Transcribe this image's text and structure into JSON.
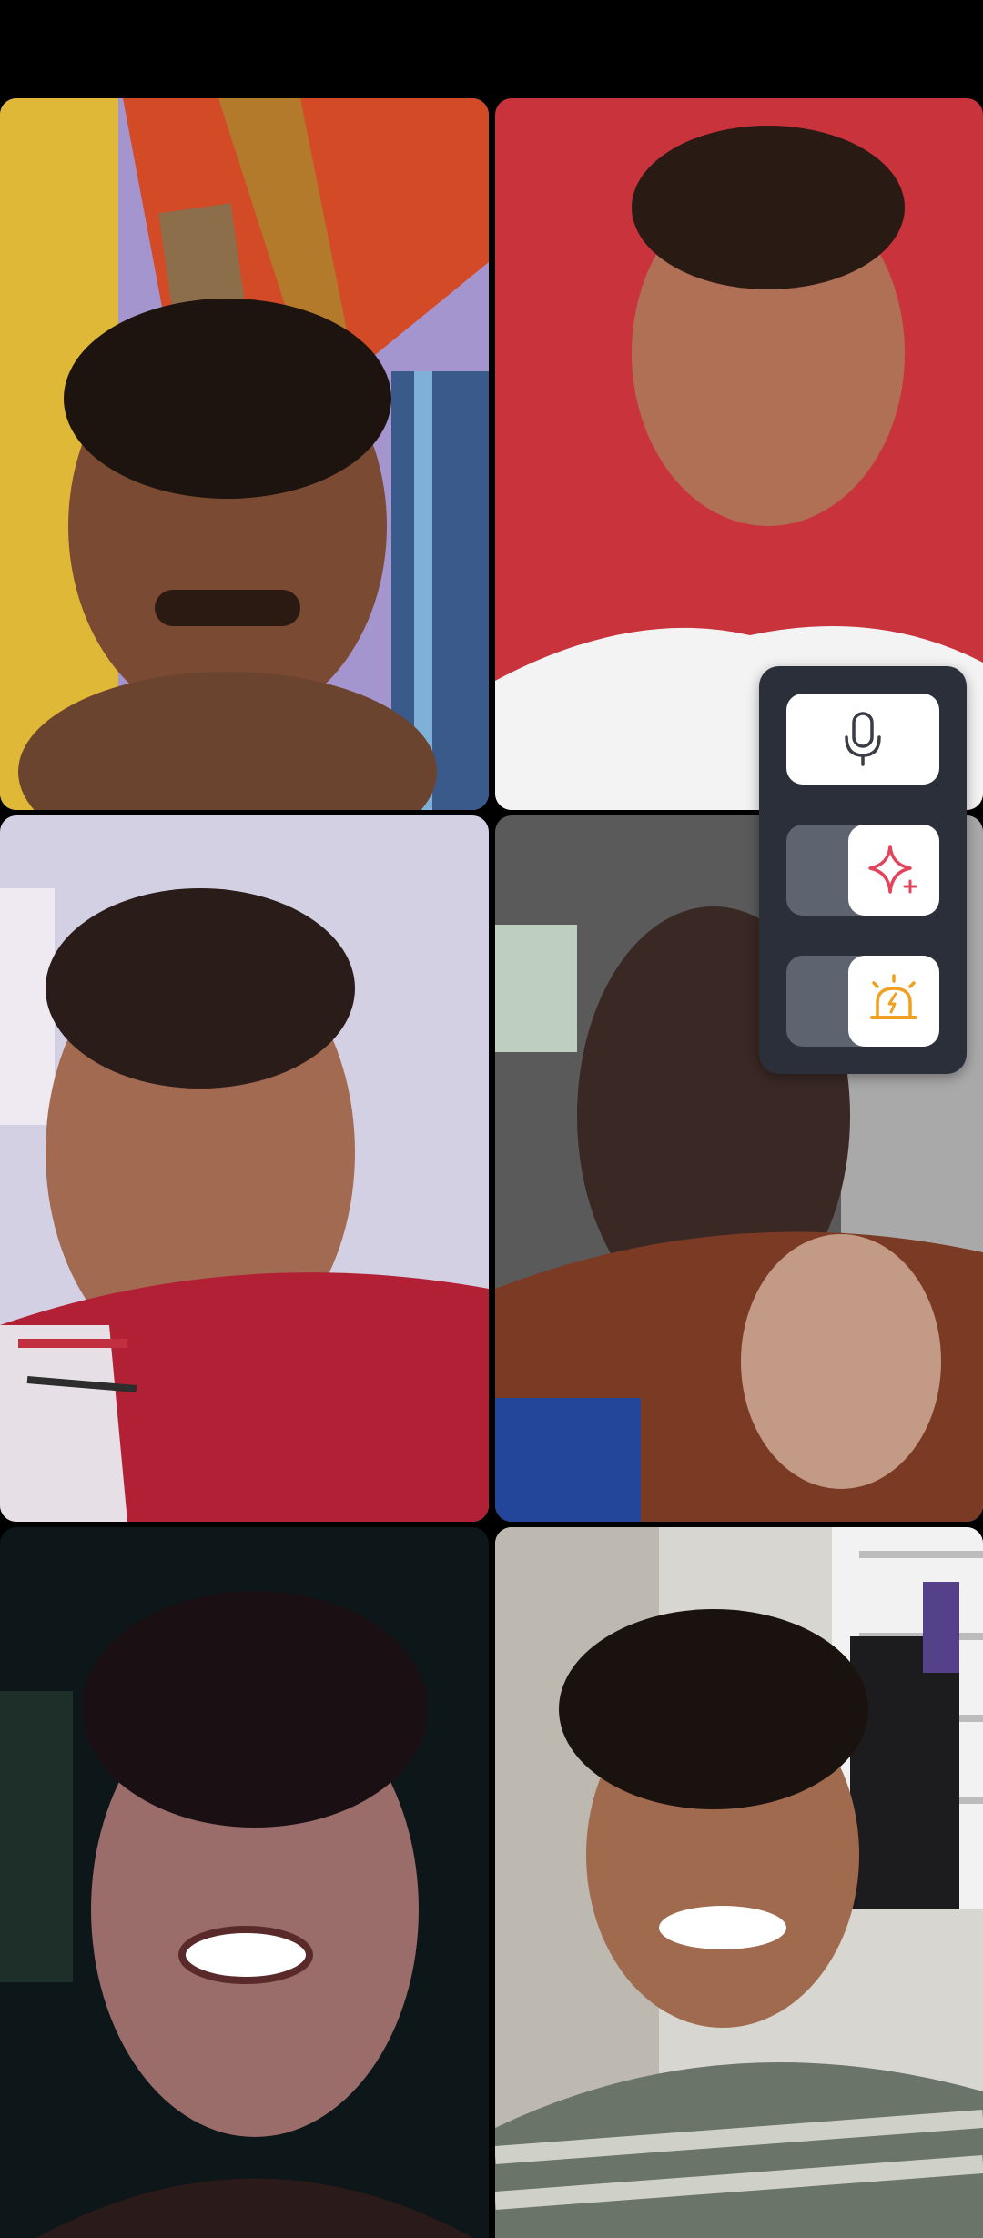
{
  "app": {
    "screen": "group-video-call"
  },
  "participants": [
    {
      "id": 1,
      "position": "top-left",
      "background": "purple-room"
    },
    {
      "id": 2,
      "position": "top-right",
      "background": "red-wall"
    },
    {
      "id": 3,
      "position": "middle-left",
      "background": "light-room"
    },
    {
      "id": 4,
      "position": "middle-right",
      "background": "dim-room"
    },
    {
      "id": 5,
      "position": "bottom-left",
      "background": "dark-room"
    },
    {
      "id": 6,
      "position": "bottom-right",
      "background": "window-room"
    }
  ],
  "controls": {
    "mic": {
      "icon": "microphone-icon",
      "state": "on"
    },
    "effects": {
      "icon": "sparkle-icon",
      "state": "off",
      "color": "#e2445c"
    },
    "flash": {
      "icon": "alarm-light-icon",
      "state": "off",
      "color": "#f0a020"
    }
  },
  "colors": {
    "panel": "#2b2f3a",
    "toggle_track": "#5e6370"
  }
}
